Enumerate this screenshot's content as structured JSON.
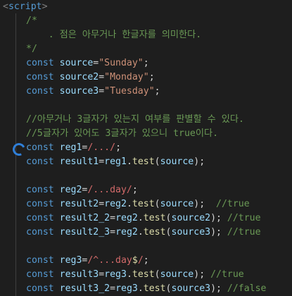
{
  "editor": {
    "lines": [
      {
        "segs": [
          {
            "t": "<",
            "c": "tag"
          },
          {
            "t": "script",
            "c": "tagname"
          },
          {
            "t": ">",
            "c": "tag"
          }
        ]
      },
      {
        "segs": [
          {
            "t": "/*",
            "c": "cm"
          }
        ]
      },
      {
        "segs": [
          {
            "t": "    . 점은 아무거나 한글자를 의미한다.",
            "c": "cm"
          }
        ]
      },
      {
        "segs": [
          {
            "t": "*/",
            "c": "cm"
          }
        ]
      },
      {
        "segs": [
          {
            "t": "const ",
            "c": "kw"
          },
          {
            "t": "source",
            "c": "var"
          },
          {
            "t": "=",
            "c": "op"
          },
          {
            "t": "\"Sunday\"",
            "c": "str"
          },
          {
            "t": ";",
            "c": "op"
          }
        ]
      },
      {
        "segs": [
          {
            "t": "const ",
            "c": "kw"
          },
          {
            "t": "source2",
            "c": "var"
          },
          {
            "t": "=",
            "c": "op"
          },
          {
            "t": "\"Monday\"",
            "c": "str"
          },
          {
            "t": ";",
            "c": "op"
          }
        ]
      },
      {
        "segs": [
          {
            "t": "const ",
            "c": "kw"
          },
          {
            "t": "source3",
            "c": "var"
          },
          {
            "t": "=",
            "c": "op"
          },
          {
            "t": "\"Tuesday\"",
            "c": "str"
          },
          {
            "t": ";",
            "c": "op"
          }
        ]
      },
      {
        "segs": []
      },
      {
        "segs": [
          {
            "t": "//아무거나 3글자가 있는지 여부를 판별할 수 있다.",
            "c": "cm"
          }
        ]
      },
      {
        "segs": [
          {
            "t": "//5글자가 있어도 3글자가 있으니 true이다.",
            "c": "cm"
          }
        ]
      },
      {
        "segs": [
          {
            "t": "const ",
            "c": "kw"
          },
          {
            "t": "reg1",
            "c": "var"
          },
          {
            "t": "=",
            "c": "op"
          },
          {
            "t": "/.../",
            "c": "re"
          },
          {
            "t": ";",
            "c": "op"
          }
        ]
      },
      {
        "segs": [
          {
            "t": "const ",
            "c": "kw"
          },
          {
            "t": "result1",
            "c": "var"
          },
          {
            "t": "=",
            "c": "op"
          },
          {
            "t": "reg1",
            "c": "var"
          },
          {
            "t": ".",
            "c": "op"
          },
          {
            "t": "test",
            "c": "fn"
          },
          {
            "t": "(",
            "c": "op"
          },
          {
            "t": "source",
            "c": "var"
          },
          {
            "t": ");",
            "c": "op"
          }
        ]
      },
      {
        "segs": []
      },
      {
        "segs": [
          {
            "t": "const ",
            "c": "kw"
          },
          {
            "t": "reg2",
            "c": "var"
          },
          {
            "t": "=",
            "c": "op"
          },
          {
            "t": "/...day/",
            "c": "re"
          },
          {
            "t": ";",
            "c": "op"
          }
        ]
      },
      {
        "segs": [
          {
            "t": "const ",
            "c": "kw"
          },
          {
            "t": "result2",
            "c": "var"
          },
          {
            "t": "=",
            "c": "op"
          },
          {
            "t": "reg2",
            "c": "var"
          },
          {
            "t": ".",
            "c": "op"
          },
          {
            "t": "test",
            "c": "fn"
          },
          {
            "t": "(",
            "c": "op"
          },
          {
            "t": "source",
            "c": "var"
          },
          {
            "t": ");  ",
            "c": "op"
          },
          {
            "t": "//true",
            "c": "cm"
          }
        ]
      },
      {
        "segs": [
          {
            "t": "const ",
            "c": "kw"
          },
          {
            "t": "result2_2",
            "c": "var"
          },
          {
            "t": "=",
            "c": "op"
          },
          {
            "t": "reg2",
            "c": "var"
          },
          {
            "t": ".",
            "c": "op"
          },
          {
            "t": "test",
            "c": "fn"
          },
          {
            "t": "(",
            "c": "op"
          },
          {
            "t": "source2",
            "c": "var"
          },
          {
            "t": "); ",
            "c": "op"
          },
          {
            "t": "//true",
            "c": "cm"
          }
        ]
      },
      {
        "segs": [
          {
            "t": "const ",
            "c": "kw"
          },
          {
            "t": "result2_3",
            "c": "var"
          },
          {
            "t": "=",
            "c": "op"
          },
          {
            "t": "reg2",
            "c": "var"
          },
          {
            "t": ".",
            "c": "op"
          },
          {
            "t": "test",
            "c": "fn"
          },
          {
            "t": "(",
            "c": "op"
          },
          {
            "t": "source3",
            "c": "var"
          },
          {
            "t": "); ",
            "c": "op"
          },
          {
            "t": "//true",
            "c": "cm"
          }
        ]
      },
      {
        "segs": []
      },
      {
        "segs": [
          {
            "t": "const ",
            "c": "kw"
          },
          {
            "t": "reg3",
            "c": "var"
          },
          {
            "t": "=",
            "c": "op"
          },
          {
            "t": "/^...day",
            "c": "re"
          },
          {
            "t": "$",
            "c": "re2"
          },
          {
            "t": "/",
            "c": "re"
          },
          {
            "t": ";",
            "c": "op"
          }
        ]
      },
      {
        "segs": [
          {
            "t": "const ",
            "c": "kw"
          },
          {
            "t": "result3",
            "c": "var"
          },
          {
            "t": "=",
            "c": "op"
          },
          {
            "t": "reg3",
            "c": "var"
          },
          {
            "t": ".",
            "c": "op"
          },
          {
            "t": "test",
            "c": "fn"
          },
          {
            "t": "(",
            "c": "op"
          },
          {
            "t": "source",
            "c": "var"
          },
          {
            "t": "); ",
            "c": "op"
          },
          {
            "t": "//true",
            "c": "cm"
          }
        ]
      },
      {
        "segs": [
          {
            "t": "const ",
            "c": "kw"
          },
          {
            "t": "result3_2",
            "c": "var"
          },
          {
            "t": "=",
            "c": "op"
          },
          {
            "t": "reg3",
            "c": "var"
          },
          {
            "t": ".",
            "c": "op"
          },
          {
            "t": "test",
            "c": "fn"
          },
          {
            "t": "(",
            "c": "op"
          },
          {
            "t": "source3",
            "c": "var"
          },
          {
            "t": "); ",
            "c": "op"
          },
          {
            "t": "//false",
            "c": "cm"
          }
        ]
      }
    ],
    "gutter_icon": "loading-spinner-icon",
    "colors": {
      "background": "#1e1e1e",
      "keyword": "#569cd6",
      "variable": "#9cdcfe",
      "string": "#ce9178",
      "regex": "#d16969",
      "function": "#dcdcaa",
      "comment": "#6a9955",
      "spinner": "#2f7fd8"
    }
  }
}
